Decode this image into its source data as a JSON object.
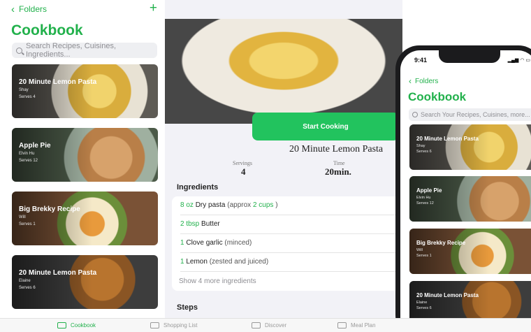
{
  "sidebar": {
    "back_label": "Folders",
    "title": "Cookbook",
    "search_placeholder": "Search Recipes, Cuisines, Ingredients...",
    "recipes": [
      {
        "title": "20 Minute Lemon Pasta",
        "author": "Shay",
        "serves": "Serves 4"
      },
      {
        "title": "Apple Pie",
        "author": "Elvin Hu",
        "serves": "Serves 12"
      },
      {
        "title": "Big Brekky Recipe",
        "author": "Will",
        "serves": "Serves 1"
      },
      {
        "title": "20 Minute Lemon Pasta",
        "author": "Elaine",
        "serves": "Serves 6"
      }
    ]
  },
  "tabbar": {
    "tabs": [
      "Cookbook",
      "Shopping List",
      "Discover",
      "Meal Plan"
    ]
  },
  "detail": {
    "start_button": "Start Cooking",
    "recipe_title": "20 Minute Lemon Pasta",
    "servings_label": "Servings",
    "servings_value": "4",
    "time_label": "Time",
    "time_value": "20min.",
    "ingredients_heading": "Ingredients",
    "ingredients": [
      {
        "qty": "8 oz",
        "name": "Dry pasta",
        "note_pre": "(approx",
        "note_qty": "2 cups",
        "note_post": ")"
      },
      {
        "qty": "2 tbsp",
        "name": "Butter",
        "note_pre": "",
        "note_qty": "",
        "note_post": ""
      },
      {
        "qty": "1",
        "name": "Clove garlic",
        "note_pre": "(minced)",
        "note_qty": "",
        "note_post": ""
      },
      {
        "qty": "1",
        "name": "Lemon",
        "note_pre": "(zested and juiced)",
        "note_qty": "",
        "note_post": ""
      }
    ],
    "show_more": "Show 4 more ingredients",
    "steps_heading": "Steps"
  },
  "phone": {
    "time": "9:41",
    "back_label": "Folders",
    "title": "Cookbook",
    "search_placeholder": "Search Your Recipes, Cuisines, more...",
    "recipes": [
      {
        "title": "20 Minute Lemon Pasta",
        "author": "Shay",
        "serves": "Serves 6"
      },
      {
        "title": "Apple Pie",
        "author": "Elvin Hu",
        "serves": "Serves 12"
      },
      {
        "title": "Big Brekky Recipe",
        "author": "Will",
        "serves": "Serves 1"
      },
      {
        "title": "20 Minute Lemon Pasta",
        "author": "Elaine",
        "serves": "Serves 6"
      }
    ]
  },
  "colors": {
    "accent": "#22b14c",
    "button": "#22c35e",
    "detail_bg": "#f2f2f7"
  },
  "icons": [
    "chevron-left-icon",
    "plus-icon",
    "search-icon",
    "share-icon",
    "tray-icon",
    "more-icon",
    "book-icon",
    "cart-icon",
    "discover-icon",
    "meal-plan-icon"
  ]
}
